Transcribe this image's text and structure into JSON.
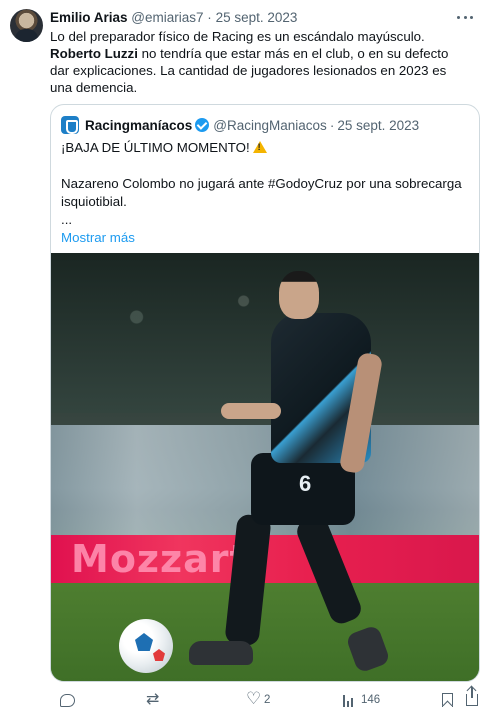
{
  "tweet": {
    "author_name": "Emilio Arias",
    "author_handle": "@emiarias7",
    "separator": "·",
    "date": "25 sept. 2023",
    "text_part1": "Lo del preparador físico de Racing es un escándalo mayúsculo. ",
    "text_bold": "Roberto Luzzi",
    "text_part2": " no tendría que estar más en el club, o en su defecto dar explicaciones. La cantidad de jugadores lesionados en 2023 es una demencia."
  },
  "quote": {
    "author_name": "Racingmaníacos",
    "author_handle": "@RacingManiacos",
    "separator": "·",
    "date": "25 sept. 2023",
    "line1": "¡BAJA DE ÚLTIMO MOMENTO!",
    "line2": "Nazareno Colombo no jugará ante #GodoyCruz por una sobrecarga isquiotibial.",
    "ellipsis": "...",
    "show_more": "Mostrar más",
    "image": {
      "shorts_number": "6",
      "ad_text": "Mozzart"
    }
  },
  "actions": {
    "reply_count": "",
    "retweet_count": "",
    "like_count": "2",
    "views_count": "146"
  },
  "colors": {
    "link": "#1d9bf0",
    "secondary_text": "#536471",
    "border": "#cfd9de",
    "verified": "#1d9bf0"
  },
  "icons": [
    "more-icon",
    "verified-icon",
    "warning-icon",
    "reply-icon",
    "retweet-icon",
    "like-icon",
    "views-icon",
    "bookmark-icon",
    "share-icon"
  ]
}
